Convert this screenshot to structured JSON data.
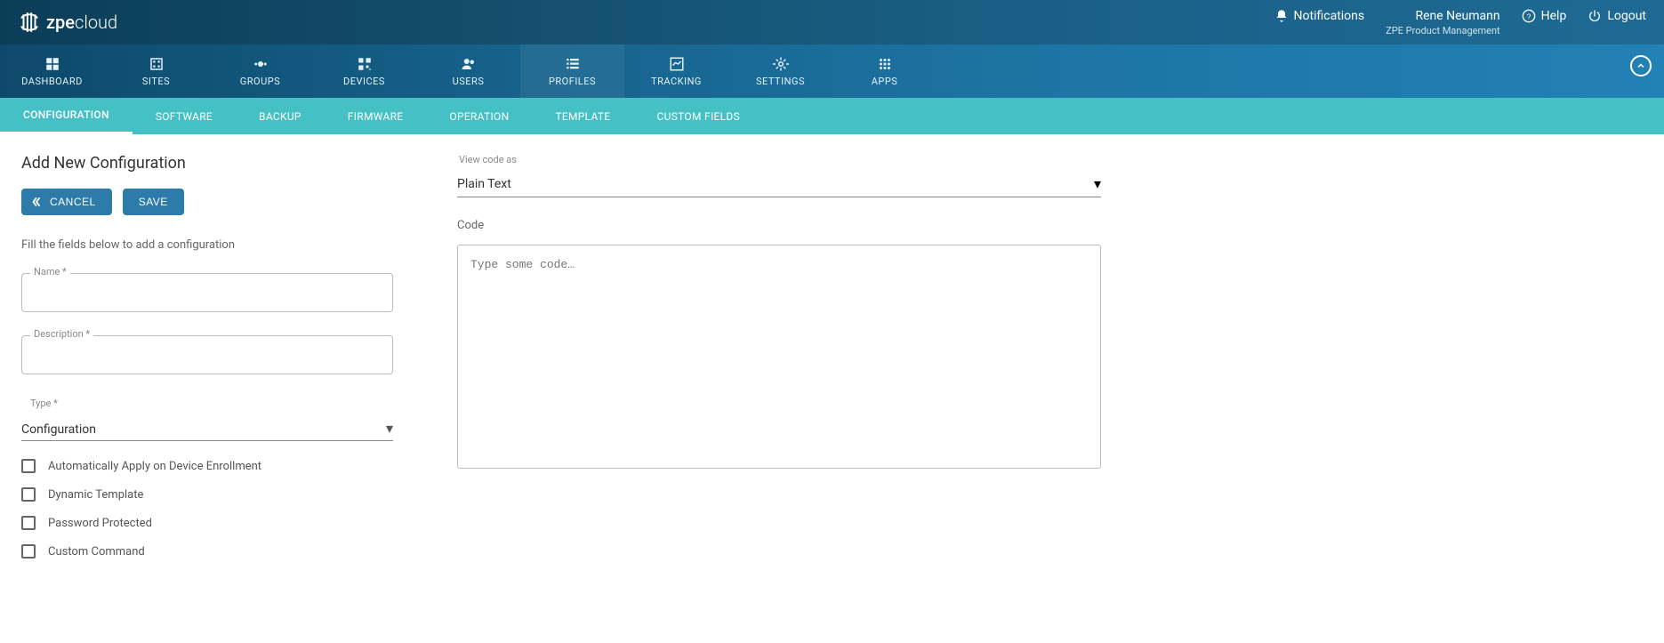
{
  "brand": {
    "name_a": "zpe",
    "name_b": "cloud"
  },
  "header": {
    "notifications": "Notifications",
    "user_name": "Rene Neumann",
    "user_org": "ZPE Product Management",
    "help": "Help",
    "logout": "Logout"
  },
  "nav": {
    "items": [
      {
        "label": "DASHBOARD"
      },
      {
        "label": "SITES"
      },
      {
        "label": "GROUPS"
      },
      {
        "label": "DEVICES"
      },
      {
        "label": "USERS"
      },
      {
        "label": "PROFILES"
      },
      {
        "label": "TRACKING"
      },
      {
        "label": "SETTINGS"
      },
      {
        "label": "APPS"
      }
    ]
  },
  "subnav": {
    "items": [
      {
        "label": "CONFIGURATION"
      },
      {
        "label": "SOFTWARE"
      },
      {
        "label": "BACKUP"
      },
      {
        "label": "FIRMWARE"
      },
      {
        "label": "OPERATION"
      },
      {
        "label": "TEMPLATE"
      },
      {
        "label": "CUSTOM FIELDS"
      }
    ]
  },
  "page": {
    "title": "Add New Configuration",
    "cancel": "CANCEL",
    "save": "SAVE",
    "help": "Fill the fields below to add a configuration",
    "name_label": "Name *",
    "name_value": "",
    "desc_label": "Description *",
    "desc_value": "",
    "type_label": "Type *",
    "type_value": "Configuration",
    "checks": [
      "Automatically Apply on Device Enrollment",
      "Dynamic Template",
      "Password Protected",
      "Custom Command"
    ],
    "vca_label": "View code as",
    "vca_value": "Plain Text",
    "code_label": "Code",
    "code_placeholder": "Type some code…"
  }
}
